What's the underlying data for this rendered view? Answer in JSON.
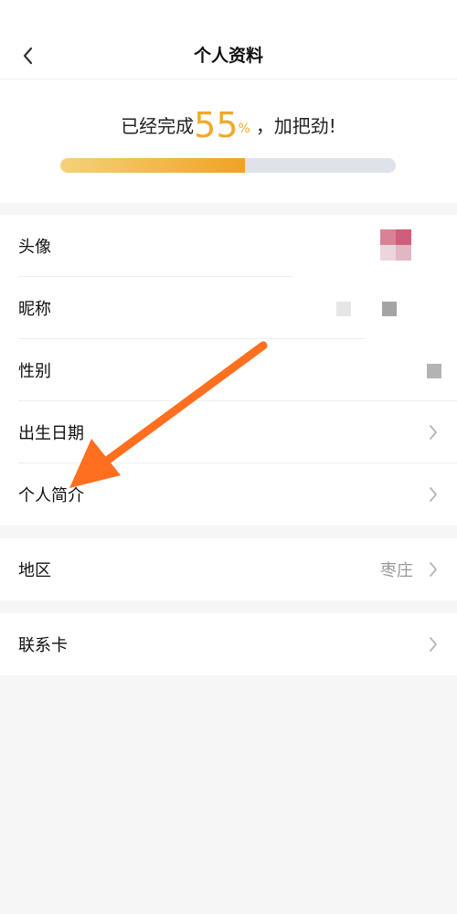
{
  "header": {
    "title": "个人资料",
    "back_icon": "chevron-left-icon"
  },
  "progress": {
    "prefix": "已经完成",
    "percent": "55",
    "percent_sign": "%",
    "suffix": "，加把劲!",
    "fraction": 0.55
  },
  "sections": [
    {
      "rows": [
        {
          "label": "头像",
          "value": ""
        },
        {
          "label": "昵称",
          "value": ""
        },
        {
          "label": "性别",
          "value": ""
        },
        {
          "label": "出生日期",
          "value": ""
        },
        {
          "label": "个人简介",
          "value": ""
        }
      ]
    },
    {
      "rows": [
        {
          "label": "地区",
          "value": "枣庄"
        }
      ]
    },
    {
      "rows": [
        {
          "label": "联系卡",
          "value": ""
        }
      ]
    }
  ],
  "colors": {
    "accent": "#f1a92b",
    "track": "#e0e2ea",
    "annotation_arrow": "#ff6f1f"
  }
}
